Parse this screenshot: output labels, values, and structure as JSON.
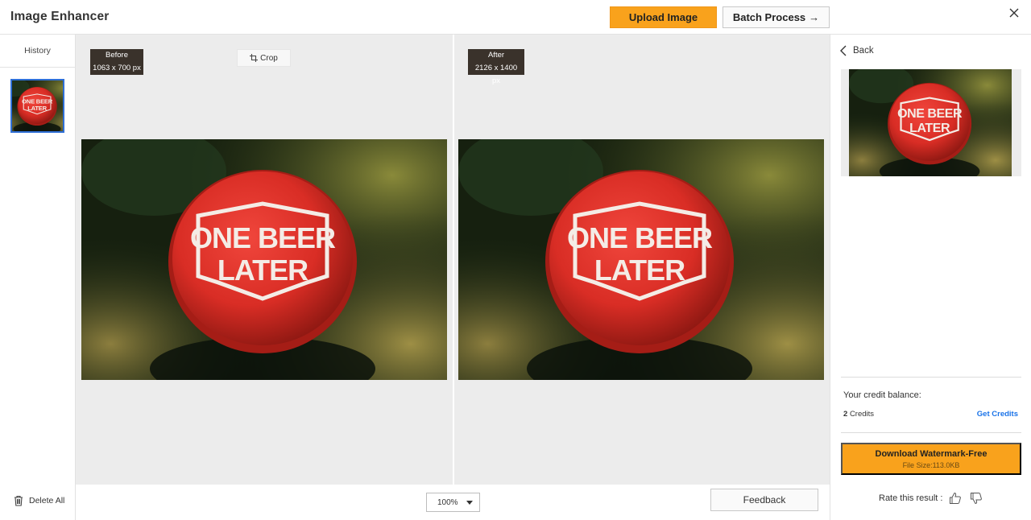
{
  "header": {
    "title": "Image Enhancer",
    "upload_label": "Upload Image",
    "batch_label": "Batch Process",
    "batch_arrow": "→"
  },
  "history": {
    "title": "History",
    "delete_all_label": "Delete All"
  },
  "compare": {
    "before_label": "Before",
    "before_size": "1063 x 700 px",
    "after_label": "After",
    "after_size": "2126 x 1400 px",
    "crop_label": "Crop",
    "image_text_line1": "ONE BEER",
    "image_text_line2": "LATER"
  },
  "bottom_bar": {
    "zoom_value": "100%",
    "feedback_label": "Feedback"
  },
  "result_panel": {
    "back_label": "Back",
    "credit_title": "Your credit balance:",
    "credit_count": "2",
    "credit_unit": "Credits",
    "get_credits_label": "Get Credits",
    "download_label": "Download Watermark-Free",
    "file_size": "File Size:113.0KB",
    "rate_label": "Rate this result :"
  },
  "colors": {
    "accent": "#f9a21c",
    "link": "#1a73e8",
    "selected_border": "#2f6fd6",
    "cap_red": "#d92d25"
  },
  "icons": [
    "close-icon",
    "arrow-right-icon",
    "crop-icon",
    "trash-icon",
    "chevron-left-icon",
    "chevron-down-icon",
    "thumbs-up-icon",
    "thumbs-down-icon"
  ]
}
